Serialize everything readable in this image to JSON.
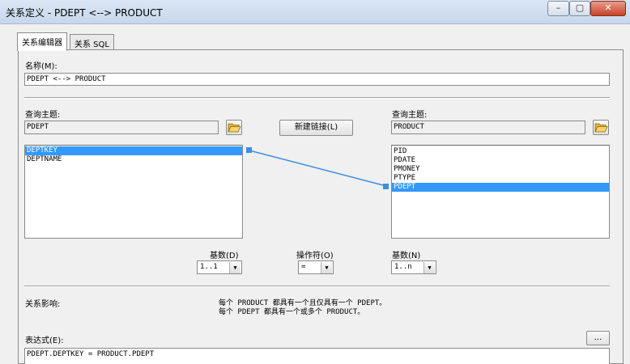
{
  "window": {
    "title": "关系定义 - PDEPT <--> PRODUCT",
    "minimize_glyph": "–",
    "maximize_glyph": "▢",
    "close_glyph": "✕"
  },
  "tabs": [
    {
      "label": "关系编辑器"
    },
    {
      "label": "关系 SQL"
    }
  ],
  "name": {
    "label": "名称(M):",
    "value": "PDEPT <--> PRODUCT"
  },
  "left": {
    "subject_label": "查询主题:",
    "subject_value": "PDEPT",
    "items": [
      "DEPTKEY",
      "DEPTNAME"
    ],
    "selected_index": 0
  },
  "new_link_button": "新建链接(L)",
  "right": {
    "subject_label": "查询主题:",
    "subject_value": "PRODUCT",
    "items": [
      "PID",
      "PDATE",
      "PMONEY",
      "PTYPE",
      "PDEPT"
    ],
    "selected_index": 4
  },
  "cardinality_left": {
    "label": "基数(D)",
    "value": "1..1"
  },
  "operator": {
    "label": "操作符(O)",
    "value": "="
  },
  "cardinality_right": {
    "label": "基数(N)",
    "value": "1..n"
  },
  "impact": {
    "label": "关系影响:",
    "line1": "每个 PRODUCT 都具有一个且仅具有一个 PDEPT。",
    "line2": "每个 PDEPT 都具有一个或多个 PRODUCT。"
  },
  "expression": {
    "label": "表达式(E):",
    "value": "PDEPT.DEPTKEY = PRODUCT.PDEPT",
    "ellipsis_button": "..."
  },
  "icons": {
    "folder": "folder-open-icon",
    "dropdown": "chevron-down-icon"
  },
  "colors": {
    "selection": "#3399ff",
    "link_line": "#3c8fe0"
  }
}
